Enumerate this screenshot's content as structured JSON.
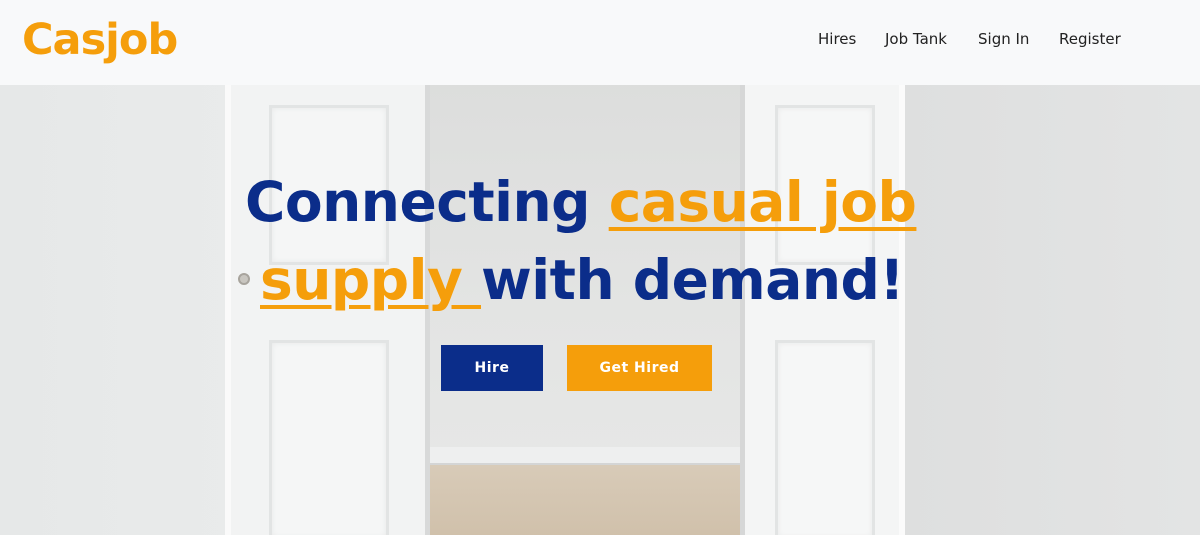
{
  "brand": {
    "name": "Casjob",
    "color": "#f59e0b"
  },
  "nav": {
    "links": [
      {
        "label": "Hires"
      },
      {
        "label": "Job Tank"
      },
      {
        "label": "Sign In"
      },
      {
        "label": "Register"
      }
    ]
  },
  "hero": {
    "headline": {
      "part1": "Connecting ",
      "accent1": "casual job",
      "accent2": "supply ",
      "part2": "with demand!"
    },
    "buttons": {
      "hire_label": "Hire",
      "get_hired_label": "Get Hired"
    },
    "colors": {
      "primary": "#0b2d8a",
      "accent": "#f59e0b"
    }
  }
}
